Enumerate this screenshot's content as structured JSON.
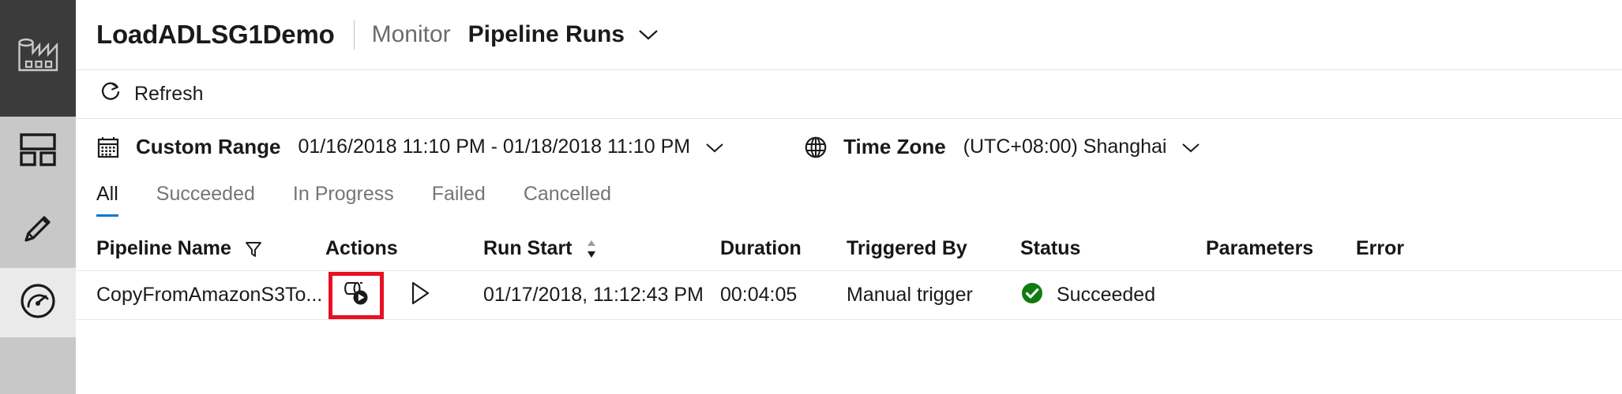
{
  "rail": {
    "logo_icon": "data-factory-logo-icon",
    "items": [
      {
        "key": "home",
        "icon": "home-dashboard-icon",
        "selected": false
      },
      {
        "key": "author",
        "icon": "pencil-author-icon",
        "selected": false
      },
      {
        "key": "monitor",
        "icon": "gauge-monitor-icon",
        "selected": true
      }
    ]
  },
  "header": {
    "factory_name": "LoadADLSG1Demo",
    "hub_label": "Monitor",
    "section_label": "Pipeline Runs",
    "section_caret_icon": "chevron-down-icon"
  },
  "command_bar": {
    "refresh_label": "Refresh",
    "refresh_icon": "refresh-circular-arrow-icon"
  },
  "filter_bar": {
    "range": {
      "icon": "calendar-icon",
      "label": "Custom Range",
      "value": "01/16/2018 11:10 PM - 01/18/2018 11:10 PM",
      "caret_icon": "chevron-down-icon"
    },
    "timezone": {
      "icon": "globe-icon",
      "label": "Time Zone",
      "value": "(UTC+08:00) Shanghai",
      "caret_icon": "chevron-down-icon"
    }
  },
  "tabs": [
    {
      "label": "All",
      "selected": true
    },
    {
      "label": "Succeeded",
      "selected": false
    },
    {
      "label": "In Progress",
      "selected": false
    },
    {
      "label": "Failed",
      "selected": false
    },
    {
      "label": "Cancelled",
      "selected": false
    }
  ],
  "table": {
    "columns": [
      {
        "key": "pipeline_name",
        "label": "Pipeline Name",
        "icon": "filter-funnel-icon"
      },
      {
        "key": "actions",
        "label": "Actions",
        "icon": ""
      },
      {
        "key": "run_start",
        "label": "Run Start",
        "icon": "sort-updown-icon"
      },
      {
        "key": "duration",
        "label": "Duration",
        "icon": ""
      },
      {
        "key": "triggered_by",
        "label": "Triggered By",
        "icon": ""
      },
      {
        "key": "status",
        "label": "Status",
        "icon": ""
      },
      {
        "key": "parameters",
        "label": "Parameters",
        "icon": ""
      },
      {
        "key": "error",
        "label": "Error",
        "icon": ""
      }
    ],
    "rows": [
      {
        "pipeline_name": "CopyFromAmazonS3To...",
        "action_view_icon": "view-activity-runs-icon",
        "action_rerun_icon": "rerun-play-triangle-icon",
        "run_start": "01/17/2018, 11:12:43 PM",
        "duration": "00:04:05",
        "triggered_by": "Manual trigger",
        "status": "Succeeded",
        "status_icon": "success-check-circle-icon",
        "parameters": "",
        "error": ""
      }
    ]
  },
  "colors": {
    "accent": "#0078d4",
    "success": "#107c10",
    "highlight_box": "#e81123",
    "rail_bg": "#c8c8c8",
    "rail_logo_bg": "#3b3b3b",
    "rail_selected_bg": "#eaeaea"
  }
}
